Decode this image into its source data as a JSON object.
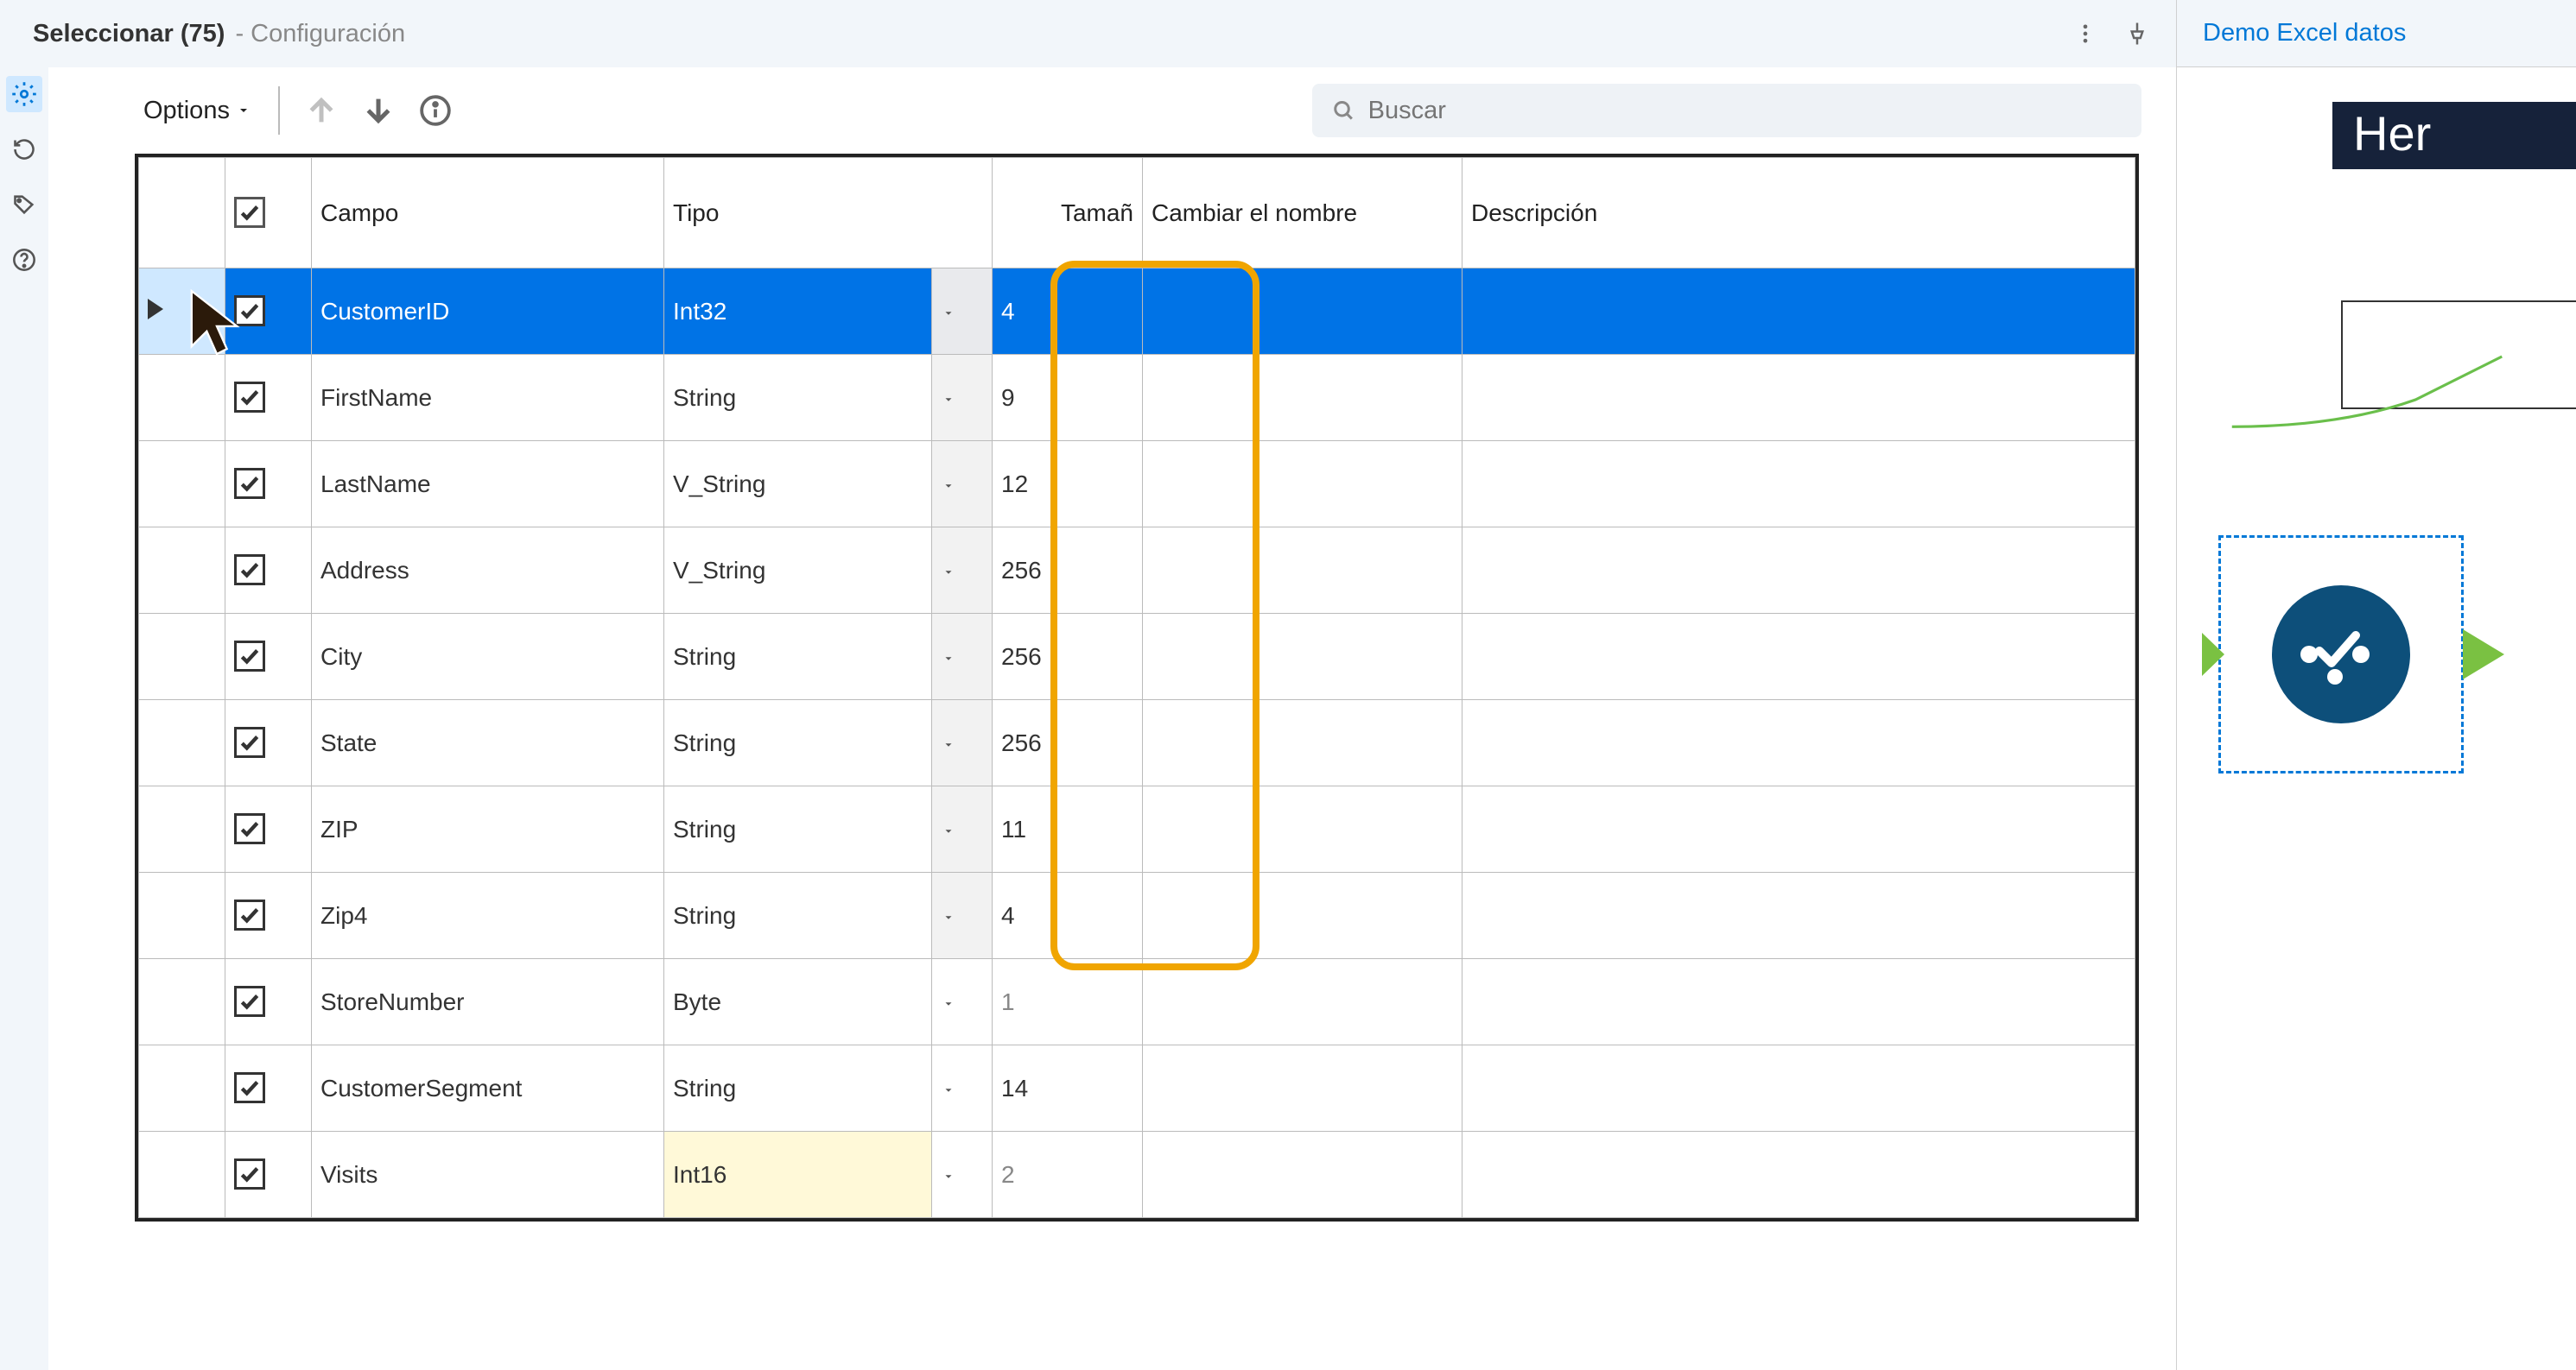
{
  "header": {
    "title_strong": "Seleccionar (75)",
    "title_light": "- Configuración"
  },
  "right_panel": {
    "title": "Demo Excel datos",
    "hero_text": "Her"
  },
  "toolbar": {
    "options_label": "Options",
    "search_placeholder": "Buscar"
  },
  "columns": {
    "field": "Campo",
    "type": "Tipo",
    "size": "Tamañ",
    "rename": "Cambiar el nombre",
    "desc": "Descripción"
  },
  "rows": [
    {
      "checked": true,
      "field": "CustomerID",
      "type": "Int32",
      "size": "4",
      "rename": "",
      "desc": "",
      "selected": true,
      "changed": false,
      "dimmed": false,
      "dd_plain": false
    },
    {
      "checked": true,
      "field": "FirstName",
      "type": "String",
      "size": "9",
      "rename": "",
      "desc": "",
      "selected": false,
      "changed": false,
      "dimmed": false,
      "dd_plain": false
    },
    {
      "checked": true,
      "field": "LastName",
      "type": "V_String",
      "size": "12",
      "rename": "",
      "desc": "",
      "selected": false,
      "changed": false,
      "dimmed": false,
      "dd_plain": false
    },
    {
      "checked": true,
      "field": "Address",
      "type": "V_String",
      "size": "256",
      "rename": "",
      "desc": "",
      "selected": false,
      "changed": false,
      "dimmed": false,
      "dd_plain": false
    },
    {
      "checked": true,
      "field": "City",
      "type": "String",
      "size": "256",
      "rename": "",
      "desc": "",
      "selected": false,
      "changed": false,
      "dimmed": false,
      "dd_plain": false
    },
    {
      "checked": true,
      "field": "State",
      "type": "String",
      "size": "256",
      "rename": "",
      "desc": "",
      "selected": false,
      "changed": false,
      "dimmed": false,
      "dd_plain": false
    },
    {
      "checked": true,
      "field": "ZIP",
      "type": "String",
      "size": "11",
      "rename": "",
      "desc": "",
      "selected": false,
      "changed": false,
      "dimmed": false,
      "dd_plain": false
    },
    {
      "checked": true,
      "field": "Zip4",
      "type": "String",
      "size": "4",
      "rename": "",
      "desc": "",
      "selected": false,
      "changed": false,
      "dimmed": false,
      "dd_plain": false
    },
    {
      "checked": true,
      "field": "StoreNumber",
      "type": "Byte",
      "size": "1",
      "rename": "",
      "desc": "",
      "selected": false,
      "changed": false,
      "dimmed": true,
      "dd_plain": true
    },
    {
      "checked": true,
      "field": "CustomerSegment",
      "type": "String",
      "size": "14",
      "rename": "",
      "desc": "",
      "selected": false,
      "changed": false,
      "dimmed": false,
      "dd_plain": true
    },
    {
      "checked": true,
      "field": "Visits",
      "type": "Int16",
      "size": "2",
      "rename": "",
      "desc": "",
      "selected": false,
      "changed": true,
      "dimmed": true,
      "dd_plain": true
    }
  ]
}
